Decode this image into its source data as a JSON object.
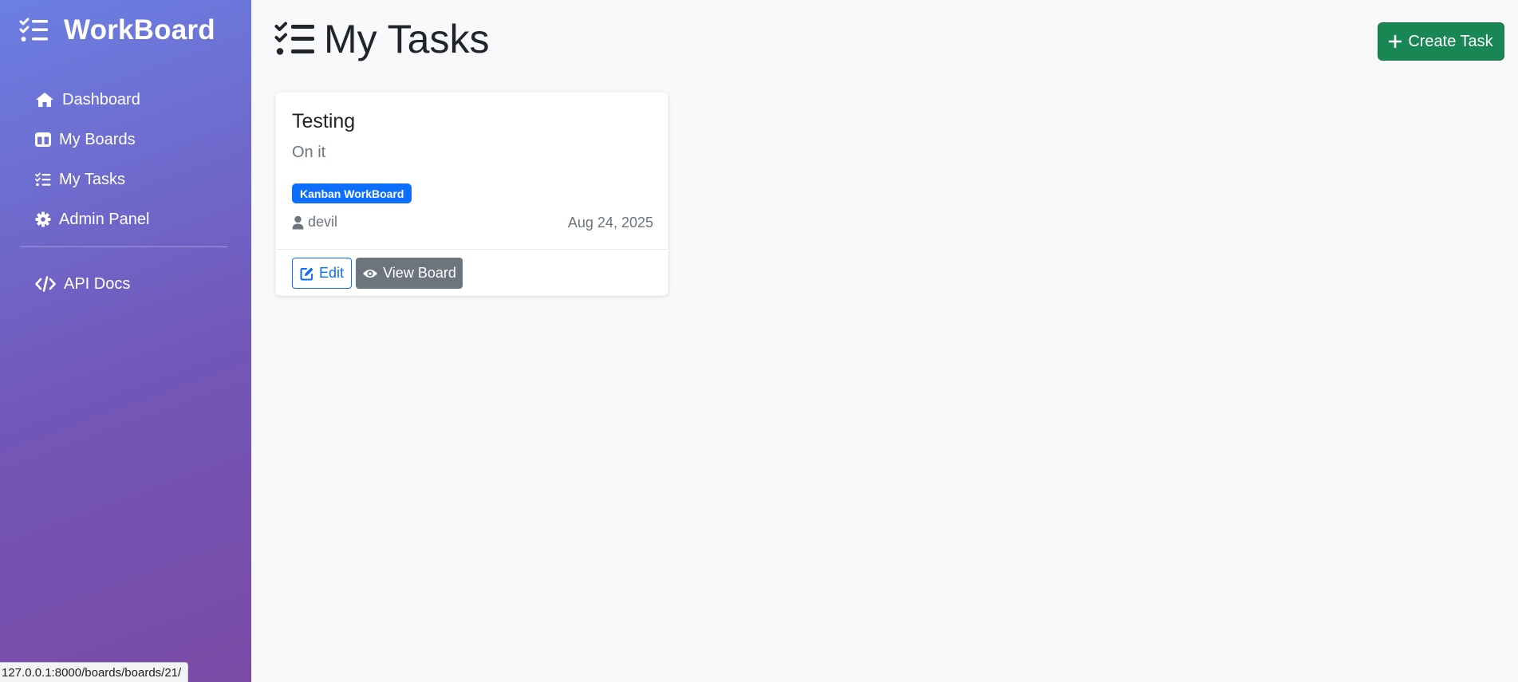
{
  "sidebar": {
    "brand": "WorkBoard",
    "brand_icon": "list-check-icon",
    "items": [
      {
        "label": "Dashboard",
        "icon": "home-icon"
      },
      {
        "label": "My Boards",
        "icon": "columns-icon"
      },
      {
        "label": "My Tasks",
        "icon": "list-check-icon"
      },
      {
        "label": "Admin Panel",
        "icon": "gear-icon"
      }
    ],
    "extra": [
      {
        "label": "API Docs",
        "icon": "code-icon"
      }
    ]
  },
  "header": {
    "title": "My Tasks",
    "title_icon": "list-check-icon",
    "create_button": "Create Task"
  },
  "task": {
    "title": "Testing",
    "description": "On it",
    "board": "Kanban WorkBoard",
    "assignee": "devil",
    "due_date": "Aug 24, 2025",
    "edit_label": "Edit",
    "view_label": "View Board"
  },
  "status_bar": {
    "url": "127.0.0.1:8000/boards/boards/21/"
  },
  "colors": {
    "sidebar_top": "#6b7fe3",
    "sidebar_bottom": "#7a4aa6",
    "primary": "#0d6efd",
    "success": "#198754",
    "secondary": "#6c757d"
  }
}
